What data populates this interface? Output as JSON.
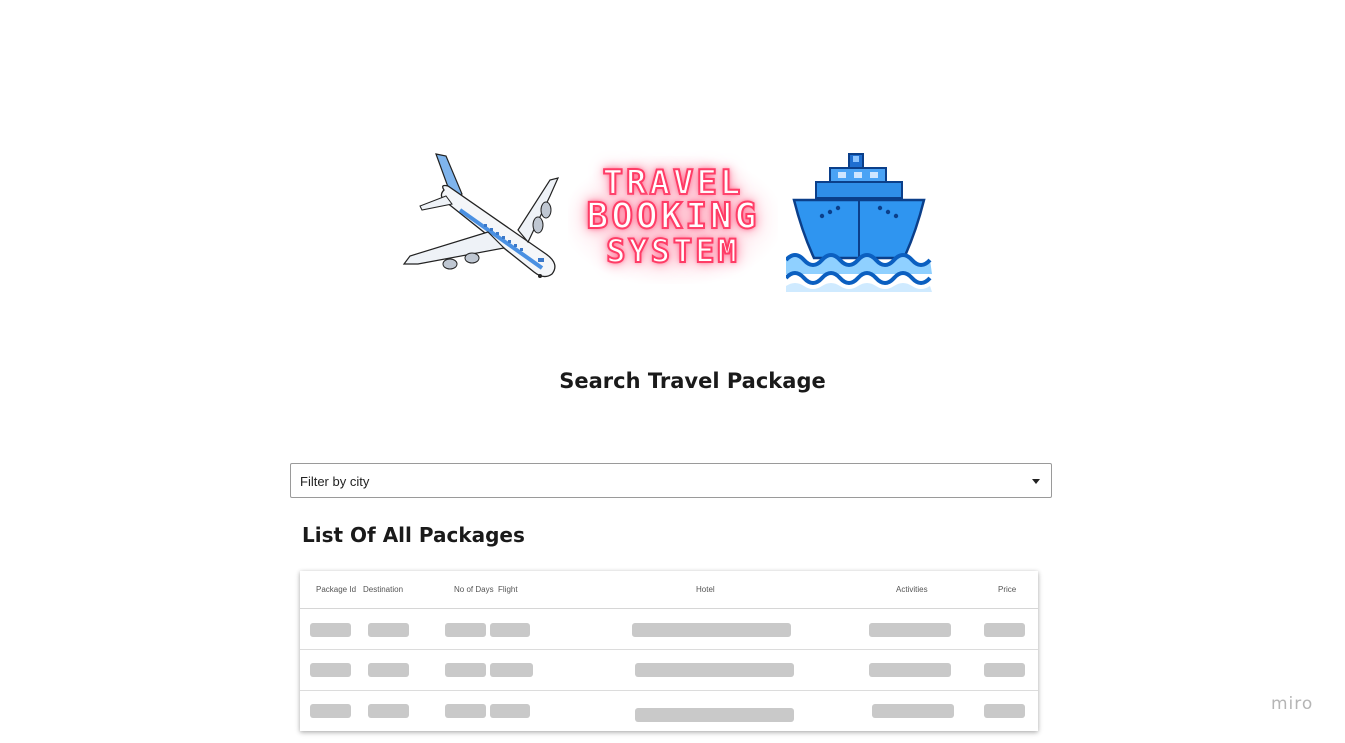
{
  "banner": {
    "logo_lines": [
      "TRAVEL",
      "BOOKING",
      "SYSTEM"
    ],
    "left_icon": "airplane-icon",
    "right_icon": "ship-icon",
    "neon_color": "#ff3c66"
  },
  "page_title": "Search Travel Package",
  "filter": {
    "label": "Filter by city",
    "icon": "caret-down-icon"
  },
  "list_title": "List Of All Packages",
  "table": {
    "columns": [
      "Package Id",
      "Destination",
      "No of Days",
      "Flight",
      "Hotel",
      "Activities",
      "Price"
    ],
    "rows": [
      {
        "state": "loading"
      },
      {
        "state": "loading"
      },
      {
        "state": "loading"
      }
    ]
  },
  "watermark": "miro"
}
